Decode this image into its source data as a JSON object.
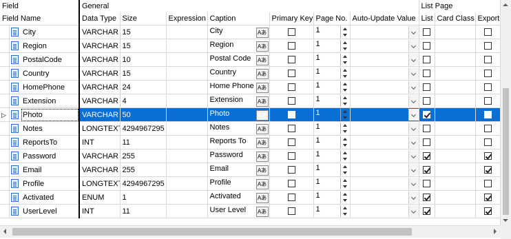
{
  "header": {
    "group_field": "Field",
    "group_general": "General",
    "group_list_page": "List Page",
    "columns": {
      "field_name": "Field Name",
      "data_type": "Data Type",
      "size": "Size",
      "expression": "Expression",
      "caption": "Caption",
      "primary_key": "Primary Key",
      "page_no": "Page No.",
      "auto_update": "Auto-Update Value",
      "list": "List",
      "card_class": "Card Class",
      "export": "Export"
    }
  },
  "lang_button_label": "Aあ",
  "selected_row_index": 6,
  "rows": [
    {
      "name": "City",
      "type": "VARCHAR",
      "size": "15",
      "caption": "City",
      "page": "1",
      "list": false,
      "export": false
    },
    {
      "name": "Region",
      "type": "VARCHAR",
      "size": "15",
      "caption": "Region",
      "page": "1",
      "list": false,
      "export": false
    },
    {
      "name": "PostalCode",
      "type": "VARCHAR",
      "size": "10",
      "caption": "Postal Code",
      "page": "1",
      "list": false,
      "export": false
    },
    {
      "name": "Country",
      "type": "VARCHAR",
      "size": "15",
      "caption": "Country",
      "page": "1",
      "list": false,
      "export": false
    },
    {
      "name": "HomePhone",
      "type": "VARCHAR",
      "size": "24",
      "caption": "Home Phone",
      "page": "1",
      "list": false,
      "export": false
    },
    {
      "name": "Extension",
      "type": "VARCHAR",
      "size": "4",
      "caption": "Extension",
      "page": "1",
      "list": false,
      "export": false
    },
    {
      "name": "Photo",
      "type": "VARCHAR",
      "size": "50",
      "caption": "Photo",
      "page": "1",
      "list": true,
      "export": false
    },
    {
      "name": "Notes",
      "type": "LONGTEXT",
      "size": "4294967295",
      "caption": "Notes",
      "page": "1",
      "list": false,
      "export": false
    },
    {
      "name": "ReportsTo",
      "type": "INT",
      "size": "11",
      "caption": "Reports To",
      "page": "1",
      "list": false,
      "export": false
    },
    {
      "name": "Password",
      "type": "VARCHAR",
      "size": "255",
      "caption": "Password",
      "page": "1",
      "list": true,
      "export": true
    },
    {
      "name": "Email",
      "type": "VARCHAR",
      "size": "255",
      "caption": "Email",
      "page": "1",
      "list": true,
      "export": true
    },
    {
      "name": "Profile",
      "type": "LONGTEXT",
      "size": "4294967295",
      "caption": "Profile",
      "page": "1",
      "list": false,
      "export": false
    },
    {
      "name": "Activated",
      "type": "ENUM",
      "size": "1",
      "caption": "Activated",
      "page": "1",
      "list": true,
      "export": true
    },
    {
      "name": "UserLevel",
      "type": "INT",
      "size": "11",
      "caption": "User Level",
      "page": "1",
      "list": true,
      "export": true
    }
  ],
  "colors": {
    "selection": "#0a6fd4",
    "field_icon": "#2b6cc4",
    "gridline": "#d8d8d8"
  },
  "icons": {
    "row_icon": "field-table-icon",
    "row_pointer": "row-pointer-icon",
    "caption_lang": "language-icon",
    "spinner": "spinner-icon",
    "dropdown": "chevron-down-icon"
  }
}
